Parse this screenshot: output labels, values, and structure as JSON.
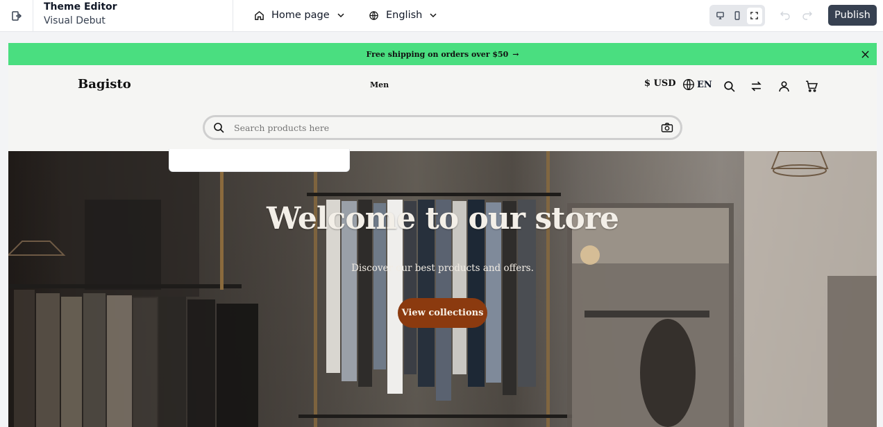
{
  "editor": {
    "title": "Theme Editor",
    "subtitle": "Visual Debut",
    "page_select": {
      "icon": "home-icon",
      "label": "Home page"
    },
    "locale_select": {
      "icon": "globe-icon",
      "label": "English"
    },
    "devices": [
      "desktop",
      "mobile",
      "fullscreen"
    ],
    "active_device": "fullscreen",
    "publish_label": "Publish"
  },
  "preview": {
    "announcement": {
      "text": "Free shipping on orders over $50",
      "arrow": "→",
      "bg": "#4ade80"
    },
    "header": {
      "logo": "Bagisto",
      "menu": [
        "Men"
      ],
      "currency": "$ USD",
      "language": "EN"
    },
    "search": {
      "placeholder": "Search products here"
    },
    "hero": {
      "title": "Welcome to our store",
      "subtitle": "Discover our best products and offers.",
      "button": "View collections",
      "button_color": "#8b3a0f"
    }
  },
  "colors": {
    "publish_bg": "#374151",
    "accent_green": "#4ade80"
  }
}
